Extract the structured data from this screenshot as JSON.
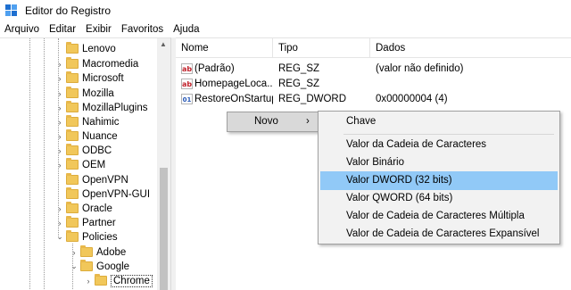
{
  "window": {
    "title": "Editor do Registro"
  },
  "menubar": [
    "Arquivo",
    "Editar",
    "Exibir",
    "Favoritos",
    "Ajuda"
  ],
  "tree": {
    "items": [
      {
        "label": "Lenovo",
        "expander": ""
      },
      {
        "label": "Macromedia",
        "expander": "›"
      },
      {
        "label": "Microsoft",
        "expander": "›"
      },
      {
        "label": "Mozilla",
        "expander": "›"
      },
      {
        "label": "MozillaPlugins",
        "expander": "›"
      },
      {
        "label": "Nahimic",
        "expander": "›"
      },
      {
        "label": "Nuance",
        "expander": "›"
      },
      {
        "label": "ODBC",
        "expander": "›"
      },
      {
        "label": "OEM",
        "expander": "›"
      },
      {
        "label": "OpenVPN",
        "expander": ""
      },
      {
        "label": "OpenVPN-GUI",
        "expander": ""
      },
      {
        "label": "Oracle",
        "expander": "›"
      },
      {
        "label": "Partner",
        "expander": "›"
      },
      {
        "label": "Policies",
        "expander": "⌄"
      },
      {
        "label": "Adobe",
        "expander": "›"
      },
      {
        "label": "Google",
        "expander": "⌄"
      },
      {
        "label": "Chrome",
        "expander": "›"
      }
    ]
  },
  "list": {
    "columns": [
      "Nome",
      "Tipo",
      "Dados"
    ],
    "rows": [
      {
        "name": "(Padrão)",
        "type": "REG_SZ",
        "data": "(valor não definido)",
        "icon": "ab"
      },
      {
        "name": "HomepageLoca...",
        "type": "REG_SZ",
        "data": "",
        "icon": "ab"
      },
      {
        "name": "RestoreOnStartup",
        "type": "REG_DWORD",
        "data": "0x00000004 (4)",
        "icon": "binary"
      }
    ]
  },
  "context_menu": {
    "label": "Novo",
    "arrow": "›"
  },
  "submenu": {
    "items": [
      "Chave",
      "Valor da Cadeia de Caracteres",
      "Valor Binário",
      "Valor DWORD (32 bits)",
      "Valor QWORD (64 bits)",
      "Valor de Cadeia de Caracteres Múltipla",
      "Valor de Cadeia de Caracteres Expansível"
    ],
    "highlighted": "Valor DWORD (32 bits)"
  },
  "icons": {
    "app": "registry-editor-icon",
    "folder": "folder-icon",
    "string": "string-value-icon",
    "binary": "binary-value-icon"
  },
  "colors": {
    "folder": "#f1c75a",
    "highlight": "#91c9f7",
    "menu_bg": "#f2f2f2"
  }
}
